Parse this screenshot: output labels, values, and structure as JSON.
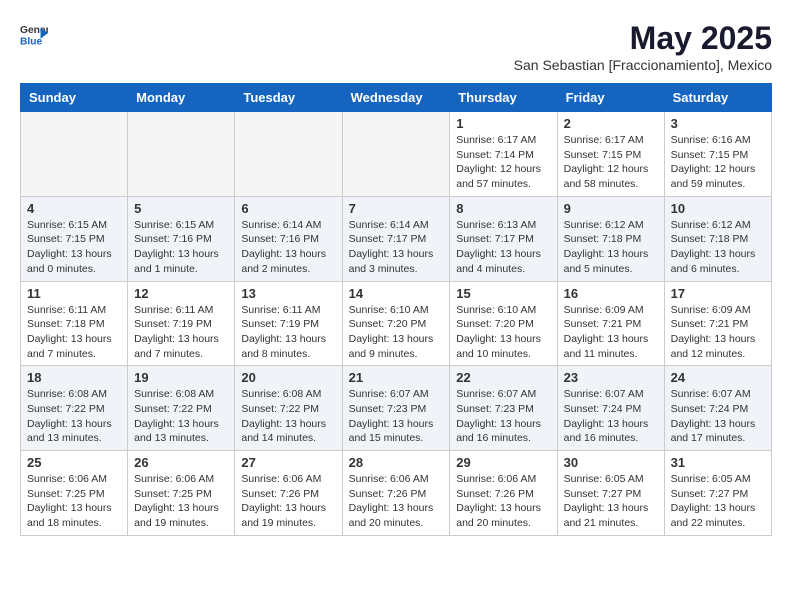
{
  "header": {
    "logo_general": "General",
    "logo_blue": "Blue",
    "month_year": "May 2025",
    "location": "San Sebastian [Fraccionamiento], Mexico"
  },
  "weekdays": [
    "Sunday",
    "Monday",
    "Tuesday",
    "Wednesday",
    "Thursday",
    "Friday",
    "Saturday"
  ],
  "weeks": [
    [
      {
        "day": "",
        "info": ""
      },
      {
        "day": "",
        "info": ""
      },
      {
        "day": "",
        "info": ""
      },
      {
        "day": "",
        "info": ""
      },
      {
        "day": "1",
        "info": "Sunrise: 6:17 AM\nSunset: 7:14 PM\nDaylight: 12 hours\nand 57 minutes."
      },
      {
        "day": "2",
        "info": "Sunrise: 6:17 AM\nSunset: 7:15 PM\nDaylight: 12 hours\nand 58 minutes."
      },
      {
        "day": "3",
        "info": "Sunrise: 6:16 AM\nSunset: 7:15 PM\nDaylight: 12 hours\nand 59 minutes."
      }
    ],
    [
      {
        "day": "4",
        "info": "Sunrise: 6:15 AM\nSunset: 7:15 PM\nDaylight: 13 hours\nand 0 minutes."
      },
      {
        "day": "5",
        "info": "Sunrise: 6:15 AM\nSunset: 7:16 PM\nDaylight: 13 hours\nand 1 minute."
      },
      {
        "day": "6",
        "info": "Sunrise: 6:14 AM\nSunset: 7:16 PM\nDaylight: 13 hours\nand 2 minutes."
      },
      {
        "day": "7",
        "info": "Sunrise: 6:14 AM\nSunset: 7:17 PM\nDaylight: 13 hours\nand 3 minutes."
      },
      {
        "day": "8",
        "info": "Sunrise: 6:13 AM\nSunset: 7:17 PM\nDaylight: 13 hours\nand 4 minutes."
      },
      {
        "day": "9",
        "info": "Sunrise: 6:12 AM\nSunset: 7:18 PM\nDaylight: 13 hours\nand 5 minutes."
      },
      {
        "day": "10",
        "info": "Sunrise: 6:12 AM\nSunset: 7:18 PM\nDaylight: 13 hours\nand 6 minutes."
      }
    ],
    [
      {
        "day": "11",
        "info": "Sunrise: 6:11 AM\nSunset: 7:18 PM\nDaylight: 13 hours\nand 7 minutes."
      },
      {
        "day": "12",
        "info": "Sunrise: 6:11 AM\nSunset: 7:19 PM\nDaylight: 13 hours\nand 7 minutes."
      },
      {
        "day": "13",
        "info": "Sunrise: 6:11 AM\nSunset: 7:19 PM\nDaylight: 13 hours\nand 8 minutes."
      },
      {
        "day": "14",
        "info": "Sunrise: 6:10 AM\nSunset: 7:20 PM\nDaylight: 13 hours\nand 9 minutes."
      },
      {
        "day": "15",
        "info": "Sunrise: 6:10 AM\nSunset: 7:20 PM\nDaylight: 13 hours\nand 10 minutes."
      },
      {
        "day": "16",
        "info": "Sunrise: 6:09 AM\nSunset: 7:21 PM\nDaylight: 13 hours\nand 11 minutes."
      },
      {
        "day": "17",
        "info": "Sunrise: 6:09 AM\nSunset: 7:21 PM\nDaylight: 13 hours\nand 12 minutes."
      }
    ],
    [
      {
        "day": "18",
        "info": "Sunrise: 6:08 AM\nSunset: 7:22 PM\nDaylight: 13 hours\nand 13 minutes."
      },
      {
        "day": "19",
        "info": "Sunrise: 6:08 AM\nSunset: 7:22 PM\nDaylight: 13 hours\nand 13 minutes."
      },
      {
        "day": "20",
        "info": "Sunrise: 6:08 AM\nSunset: 7:22 PM\nDaylight: 13 hours\nand 14 minutes."
      },
      {
        "day": "21",
        "info": "Sunrise: 6:07 AM\nSunset: 7:23 PM\nDaylight: 13 hours\nand 15 minutes."
      },
      {
        "day": "22",
        "info": "Sunrise: 6:07 AM\nSunset: 7:23 PM\nDaylight: 13 hours\nand 16 minutes."
      },
      {
        "day": "23",
        "info": "Sunrise: 6:07 AM\nSunset: 7:24 PM\nDaylight: 13 hours\nand 16 minutes."
      },
      {
        "day": "24",
        "info": "Sunrise: 6:07 AM\nSunset: 7:24 PM\nDaylight: 13 hours\nand 17 minutes."
      }
    ],
    [
      {
        "day": "25",
        "info": "Sunrise: 6:06 AM\nSunset: 7:25 PM\nDaylight: 13 hours\nand 18 minutes."
      },
      {
        "day": "26",
        "info": "Sunrise: 6:06 AM\nSunset: 7:25 PM\nDaylight: 13 hours\nand 19 minutes."
      },
      {
        "day": "27",
        "info": "Sunrise: 6:06 AM\nSunset: 7:26 PM\nDaylight: 13 hours\nand 19 minutes."
      },
      {
        "day": "28",
        "info": "Sunrise: 6:06 AM\nSunset: 7:26 PM\nDaylight: 13 hours\nand 20 minutes."
      },
      {
        "day": "29",
        "info": "Sunrise: 6:06 AM\nSunset: 7:26 PM\nDaylight: 13 hours\nand 20 minutes."
      },
      {
        "day": "30",
        "info": "Sunrise: 6:05 AM\nSunset: 7:27 PM\nDaylight: 13 hours\nand 21 minutes."
      },
      {
        "day": "31",
        "info": "Sunrise: 6:05 AM\nSunset: 7:27 PM\nDaylight: 13 hours\nand 22 minutes."
      }
    ]
  ]
}
